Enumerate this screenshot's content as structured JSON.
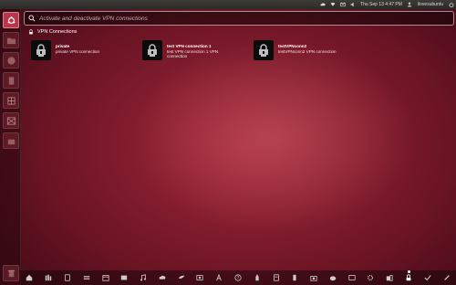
{
  "top_panel": {
    "datetime": "Thu Sep 13  4:47 PM",
    "username": "ilovesubuntu"
  },
  "search": {
    "placeholder": "Activate and deactivate VPN connections"
  },
  "category": {
    "title": "VPN Connections"
  },
  "results": [
    {
      "title": "private",
      "description": "private VPN connection"
    },
    {
      "title": "test VPN connection 1",
      "description": "test VPN connection 1 VPN connection"
    },
    {
      "title": "testVPNconn2",
      "description": "testVPNconn2 VPN connection"
    }
  ],
  "colors": {
    "background": "#8e2034",
    "panel": "#3c3b37",
    "launcher_home": "#b8364a"
  }
}
